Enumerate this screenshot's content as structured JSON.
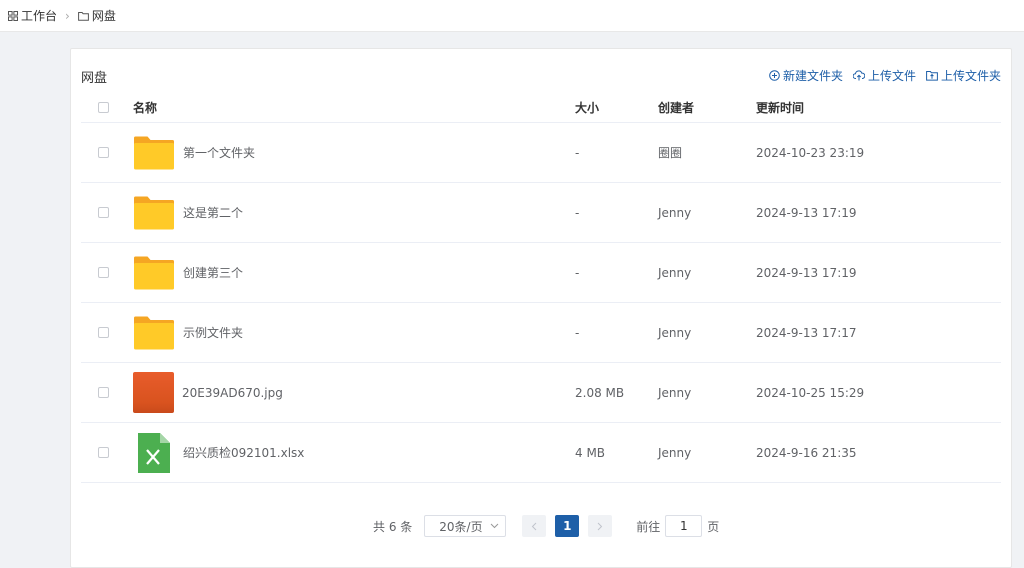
{
  "breadcrumb": {
    "home": "工作台",
    "current": "网盘"
  },
  "panel": {
    "title": "网盘"
  },
  "actions": {
    "new_folder": "新建文件夹",
    "upload_file": "上传文件",
    "upload_folder": "上传文件夹"
  },
  "table": {
    "headers": {
      "name": "名称",
      "size": "大小",
      "creator": "创建者",
      "time": "更新时间"
    },
    "rows": [
      {
        "type": "folder",
        "name": "第一个文件夹",
        "size": "-",
        "creator": "圈圈",
        "time": "2024-10-23 23:19"
      },
      {
        "type": "folder",
        "name": "这是第二个",
        "size": "-",
        "creator": "Jenny",
        "time": "2024-9-13 17:19"
      },
      {
        "type": "folder",
        "name": "创建第三个",
        "size": "-",
        "creator": "Jenny",
        "time": "2024-9-13 17:19"
      },
      {
        "type": "folder",
        "name": "示例文件夹",
        "size": "-",
        "creator": "Jenny",
        "time": "2024-9-13 17:17"
      },
      {
        "type": "image",
        "name": "20E39AD670.jpg",
        "size": "2.08 MB",
        "creator": "Jenny",
        "time": "2024-10-25 15:29"
      },
      {
        "type": "excel",
        "name": "绍兴质检092101.xlsx",
        "size": "4 MB",
        "creator": "Jenny",
        "time": "2024-9-16 21:35"
      }
    ]
  },
  "pagination": {
    "total": "共 6 条",
    "page_size": "20条/页",
    "current_page": "1",
    "goto_prefix": "前往",
    "goto_value": "1",
    "goto_suffix": "页"
  },
  "colors": {
    "accent": "#1e5fa8",
    "folder": "#ffc107",
    "excel": "#4caf50",
    "image": "#e55a2b"
  }
}
